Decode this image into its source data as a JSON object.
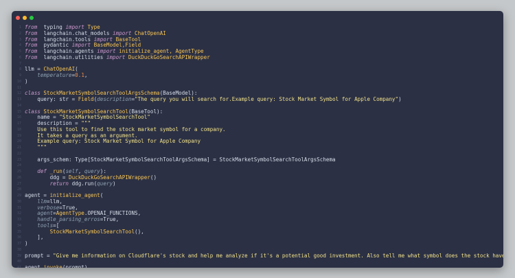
{
  "window": {
    "dots": [
      "close",
      "minimize",
      "maximize"
    ]
  },
  "colors": {
    "background": "#c5c8ca",
    "editor": "#2b3044",
    "keyword": "#cc99cd",
    "function": "#f8c555",
    "string": "#f0e08a",
    "text": "#d8dee9"
  },
  "code": {
    "lines": [
      [
        [
          "kw",
          "from"
        ],
        [
          "",
          "  typing "
        ],
        [
          "kw",
          "import"
        ],
        [
          "fn",
          " Type"
        ]
      ],
      [
        [
          "kw",
          "from"
        ],
        [
          "",
          "  langchain.chat_models "
        ],
        [
          "kw",
          "import"
        ],
        [
          "fn",
          " ChatOpenAI"
        ]
      ],
      [
        [
          "kw",
          "from"
        ],
        [
          "",
          "  langchain.tools "
        ],
        [
          "kw",
          "import"
        ],
        [
          "fn",
          " BaseTool"
        ]
      ],
      [
        [
          "kw",
          "from"
        ],
        [
          "",
          "  pydantic "
        ],
        [
          "kw",
          "import"
        ],
        [
          "fn",
          " BaseModel,Field"
        ]
      ],
      [
        [
          "kw",
          "from"
        ],
        [
          "",
          "  langchain.agents "
        ],
        [
          "kw",
          "import"
        ],
        [
          "fn",
          " initialize_agent, AgentType"
        ]
      ],
      [
        [
          "kw",
          "from"
        ],
        [
          "",
          "  langchain.utilities "
        ],
        [
          "kw",
          "import"
        ],
        [
          "fn",
          " DuckDuckGoSearchAPIWrapper"
        ]
      ],
      [],
      [
        [
          "",
          "llm = "
        ],
        [
          "fn",
          "ChatOpenAI"
        ],
        [
          "",
          "("
        ]
      ],
      [
        [
          "",
          "    "
        ],
        [
          "par",
          "temperature"
        ],
        [
          "",
          "="
        ],
        [
          "num",
          "0.1"
        ],
        [
          "",
          ","
        ]
      ],
      [
        [
          "",
          ")"
        ]
      ],
      [],
      [
        [
          "kw",
          "class"
        ],
        [
          "fn",
          " StockMarketSymbolSearchToolArgsSchema"
        ],
        [
          "",
          "(BaseModel):"
        ]
      ],
      [
        [
          "",
          "    query: str = "
        ],
        [
          "fn",
          "Field"
        ],
        [
          "",
          "("
        ],
        [
          "par",
          "description"
        ],
        [
          "",
          "="
        ],
        [
          "str",
          "\"The query you will search for.Example query: Stock Market Symbol for Apple Company\""
        ],
        [
          "",
          ")"
        ]
      ],
      [],
      [
        [
          "kw",
          "class"
        ],
        [
          "fn",
          " StockMarketSymbolSearchTool"
        ],
        [
          "",
          "(BaseTool):"
        ]
      ],
      [
        [
          "",
          "    name = "
        ],
        [
          "str",
          "\"StockMarketSymbolSearchTool\""
        ]
      ],
      [
        [
          "",
          "    description = "
        ],
        [
          "str",
          "\"\"\""
        ]
      ],
      [
        [
          "str",
          "    Use this tool to find the stock market symbol for a company."
        ]
      ],
      [
        [
          "str",
          "    It takes a query as an argument."
        ]
      ],
      [
        [
          "str",
          "    Example query: Stock Market Symbol for Apple Company"
        ]
      ],
      [
        [
          "str",
          "    \"\"\""
        ]
      ],
      [],
      [
        [
          "",
          "    args_schem: Type[StockMarketSymbolSearchToolArgsSchema] = StockMarketSymbolSearchToolArgsSchema"
        ]
      ],
      [],
      [
        [
          "kw",
          "    def"
        ],
        [
          "fn",
          " _run"
        ],
        [
          "",
          "("
        ],
        [
          "par",
          "self"
        ],
        [
          "",
          ", "
        ],
        [
          "par",
          "query"
        ],
        [
          "",
          "):"
        ]
      ],
      [
        [
          "",
          "        ddg = "
        ],
        [
          "fn",
          "DuckDuckGoSearchAPIWrapper"
        ],
        [
          "",
          "()"
        ]
      ],
      [
        [
          "kw",
          "        return"
        ],
        [
          "",
          " ddg.run("
        ],
        [
          "par",
          "query"
        ],
        [
          "",
          ")"
        ]
      ],
      [],
      [
        [
          "",
          "agent = "
        ],
        [
          "fn",
          "initialize_agent"
        ],
        [
          "",
          "("
        ]
      ],
      [
        [
          "par",
          "    llm"
        ],
        [
          "",
          "=llm,"
        ]
      ],
      [
        [
          "par",
          "    verbose"
        ],
        [
          "",
          "=True,"
        ]
      ],
      [
        [
          "par",
          "    agent"
        ],
        [
          "",
          "="
        ],
        [
          "fn",
          "AgentType"
        ],
        [
          "",
          ".OPENAI_FUNCTIONS,"
        ]
      ],
      [
        [
          "par",
          "    handle_parsing_erros"
        ],
        [
          "",
          "=True,"
        ]
      ],
      [
        [
          "par",
          "    tools"
        ],
        [
          "",
          "=["
        ]
      ],
      [
        [
          "fn",
          "        StockMarketSymbolSearchTool"
        ],
        [
          "",
          "(),"
        ]
      ],
      [
        [
          "",
          "    ],"
        ]
      ],
      [
        [
          "",
          ")"
        ]
      ],
      [],
      [
        [
          "",
          "prompt = "
        ],
        [
          "str",
          "\"Give me information on Cloudflare's stock and help me analyze if it's a potential good investment. Also tell me what symbol does the stock have.\""
        ]
      ],
      [],
      [
        [
          "",
          "agent."
        ],
        [
          "fn",
          "invoke"
        ],
        [
          "",
          "(prompt)"
        ]
      ]
    ]
  }
}
